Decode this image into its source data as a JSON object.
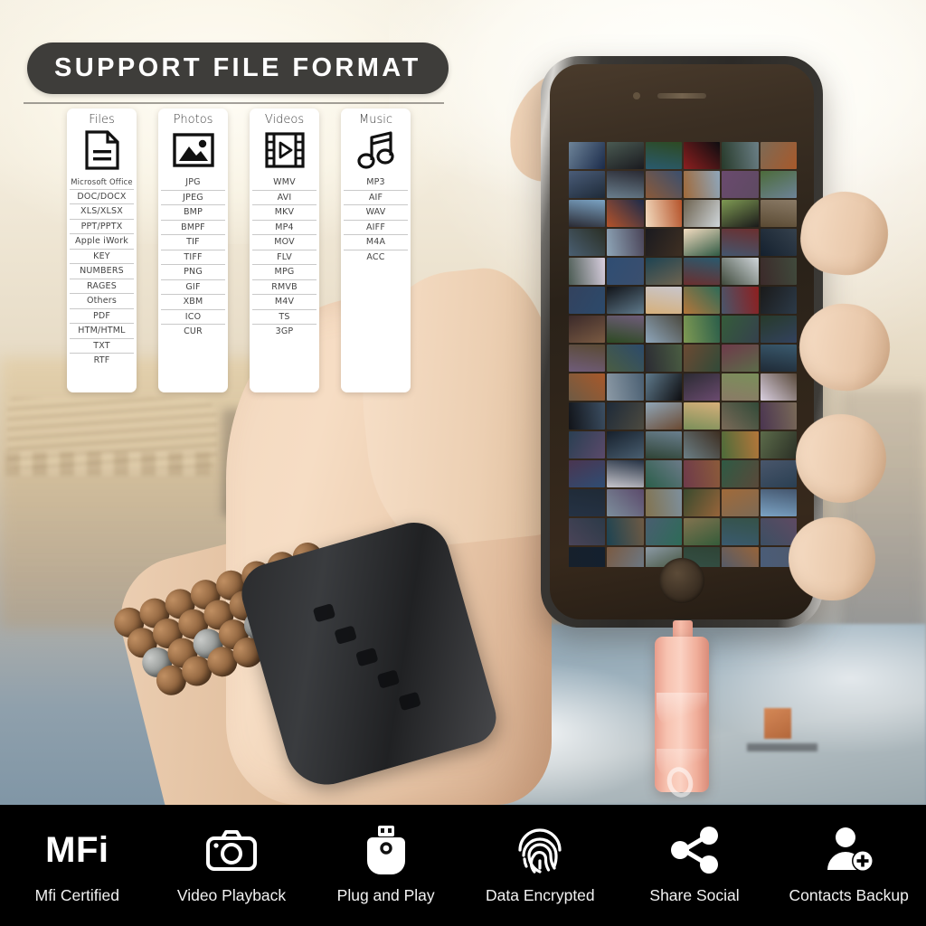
{
  "header": {
    "title": "SUPPORT FILE FORMAT"
  },
  "format_cards": [
    {
      "title": "Files",
      "icon": "document-icon",
      "formats": [
        "Microsoft Office",
        "DOC/DOCX",
        "XLS/XLSX",
        "PPT/PPTX",
        "Apple iWork",
        "KEY",
        "NUMBERS",
        "RAGES",
        "Others",
        "PDF",
        "HTM/HTML",
        "TXT",
        "RTF"
      ]
    },
    {
      "title": "Photos",
      "icon": "image-icon",
      "formats": [
        "JPG",
        "JPEG",
        "BMP",
        "BMPF",
        "TIF",
        "TIFF",
        "PNG",
        "GIF",
        "XBM",
        "ICO",
        "CUR"
      ]
    },
    {
      "title": "Videos",
      "icon": "film-play-icon",
      "formats": [
        "WMV",
        "AVI",
        "MKV",
        "MP4",
        "MOV",
        "FLV",
        "MPG",
        "RMVB",
        "M4V",
        "TS",
        "3GP"
      ]
    },
    {
      "title": "Music",
      "icon": "music-note-icon",
      "formats": [
        "MP3",
        "AIF",
        "WAV",
        "AIFF",
        "M4A",
        "ACC"
      ]
    }
  ],
  "features": [
    {
      "label": "Mfi Certified",
      "icon": "mfi-text-icon",
      "glyph": "MFi"
    },
    {
      "label": "Video Playback",
      "icon": "camera-icon",
      "glyph": ""
    },
    {
      "label": "Plug and Play",
      "icon": "usb-drive-icon",
      "glyph": ""
    },
    {
      "label": "Data Encrypted",
      "icon": "fingerprint-icon",
      "glyph": ""
    },
    {
      "label": "Share Social",
      "icon": "share-icon",
      "glyph": ""
    },
    {
      "label": "Contacts Backup",
      "icon": "add-contact-icon",
      "glyph": ""
    }
  ],
  "product": {
    "device": "smartphone",
    "accessory": "usb-flash-drive",
    "accessory_color": "#f2b3a1",
    "screen_content": "photo-gallery-grid"
  },
  "colors": {
    "banner_bg": "#3e3d3a",
    "banner_text": "#ffffff",
    "card_bg": "#ffffff",
    "feature_bar_bg": "#000000",
    "feature_text": "#f2f2f2",
    "accent_pink": "#f2b3a1"
  },
  "gallery": {
    "columns": 6,
    "thumbs": [
      "#6d8398",
      "#4a5a52",
      "#2d4a22",
      "#0d0d10",
      "#6b7f86",
      "#7d6a55",
      "#4a5c78",
      "#2a2a33",
      "#3b4f6e",
      "#8ea6bb",
      "#6a4a6e",
      "#4c6b3a",
      "#7ba3c4",
      "#1b2b4a",
      "#b5532a",
      "#6e6350",
      "#7f9a53",
      "#8a7a66",
      "#2a2f25",
      "#4a4458",
      "#1a1a1f",
      "#f3dcc0",
      "#6b2f2f",
      "#35414d",
      "#d9cfe0",
      "#2f4d73",
      "#1d4352",
      "#2a5a6e",
      "#cfd6da",
      "#404a3c",
      "#33425e",
      "#111318",
      "#c8c6cc",
      "#2e6b58",
      "#8d1f1f",
      "#1a1a1a",
      "#3b2a2a",
      "#6f5c7a",
      "#4c4a40",
      "#2b5e4a",
      "#355c3a",
      "#273a2a",
      "#5a4a33",
      "#2c4a6b",
      "#4a5d42",
      "#6b4a33",
      "#6e3a4a",
      "#3a5a6e",
      "#a8592a",
      "#4a5f72",
      "#5f7a8c",
      "#2b2b33",
      "#7a8f5a",
      "#59493a",
      "#3c4f63",
      "#1e2a38",
      "#8fa6b8",
      "#d6b07a",
      "#324a38",
      "#7a6a58",
      "#2a3f52",
      "#16202c",
      "#6a7f8e",
      "#3e2f22",
      "#b4763a",
      "#5c6b4a",
      "#4a3550",
      "#253244",
      "#6b7a88",
      "#8b5a3a",
      "#2f5a44",
      "#49566b",
      "#1f2a36",
      "#5b4a6b",
      "#7d8f9c",
      "#3a4a2e",
      "#a06a3a",
      "#44566e",
      "#2c3a48",
      "#6e5a44",
      "#495e70",
      "#82734f",
      "#355248",
      "#5e4a62",
      "#14202e",
      "#7a5a42",
      "#8c9aa6",
      "#2f4436",
      "#96643a",
      "#4e5a6e"
    ]
  }
}
